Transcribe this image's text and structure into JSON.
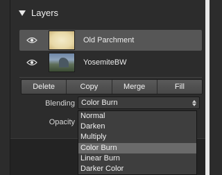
{
  "panel": {
    "title": "Layers",
    "icons": {
      "collapse": "disclosure-triangle-down-icon",
      "visibility": "eye-icon"
    }
  },
  "layers": [
    {
      "name": "Old Parchment",
      "visible": true,
      "selected": true,
      "thumbnail": "parchment-thumbnail"
    },
    {
      "name": "YosemiteBW",
      "visible": true,
      "selected": false,
      "thumbnail": "yosemite-thumbnail"
    }
  ],
  "buttons": {
    "delete": "Delete",
    "copy": "Copy",
    "merge": "Merge",
    "fill": "Fill"
  },
  "blending": {
    "label": "Blending",
    "value": "Color Burn",
    "options": [
      "Normal",
      "Darken",
      "Multiply",
      "Color Burn",
      "Linear Burn",
      "Darker Color"
    ],
    "highlighted_index": 3
  },
  "opacity": {
    "label": "Opacity"
  },
  "colors": {
    "panel_bg": "#2c2c2c",
    "selected_row": "#565656",
    "menu_bg": "#3e3e3e",
    "menu_highlight": "#6a6a6a"
  }
}
